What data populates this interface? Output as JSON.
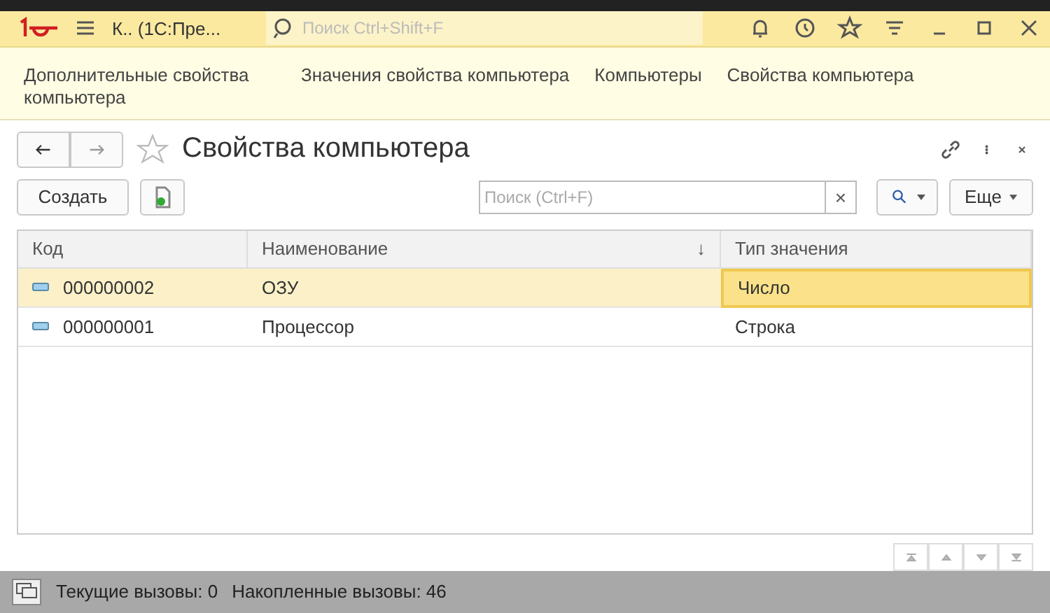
{
  "window": {
    "title": "К..  (1С:Пре...",
    "search_placeholder": "Поиск Ctrl+Shift+F"
  },
  "nav": [
    "Дополнительные свойства компьютера",
    "Значения свойства компьютера",
    "Компьютеры",
    "Свойства компьютера"
  ],
  "form": {
    "title": "Свойства компьютера",
    "create_button": "Создать",
    "search_placeholder": "Поиск (Ctrl+F)",
    "clear": "×",
    "more_button": "Еще"
  },
  "table": {
    "columns": [
      "Код",
      "Наименование",
      "Тип значения"
    ],
    "sort_mark": "↓",
    "rows": [
      {
        "code": "000000002",
        "name": "ОЗУ",
        "type": "Число",
        "selected": true
      },
      {
        "code": "000000001",
        "name": "Процессор",
        "type": "Строка",
        "selected": false
      }
    ]
  },
  "status_bar": {
    "current": "Текущие вызовы: 0",
    "accumulated": "Накопленные вызовы: 46"
  }
}
